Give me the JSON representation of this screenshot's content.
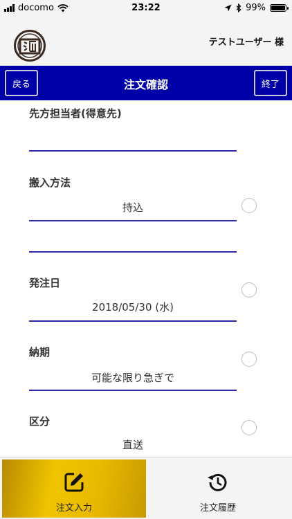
{
  "status_bar": {
    "carrier": "docomo",
    "time": "23:22",
    "battery": "99%",
    "battery_level": 0.99
  },
  "header": {
    "user": "テストユーザー 様"
  },
  "nav": {
    "back_label": "戻る",
    "title": "注文確認",
    "end_label": "終了"
  },
  "form": {
    "fields": [
      {
        "label": "先方担当者(得意先)",
        "value": ""
      },
      {
        "label": "搬入方法",
        "value": "持込",
        "extra_value": ""
      },
      {
        "label": "発注日",
        "value": "2018/05/30 (水)"
      },
      {
        "label": "納期",
        "value": "可能な限り急ぎで"
      },
      {
        "label": "区分",
        "value": "直送"
      }
    ]
  },
  "tabs": [
    {
      "label": "注文入力",
      "icon": "edit-icon",
      "active": true
    },
    {
      "label": "注文履歴",
      "icon": "history-icon",
      "active": false
    }
  ],
  "colors": {
    "nav_bg": "#0000a8",
    "underline": "#2a2aa8",
    "active_tab": "#f0c400"
  }
}
